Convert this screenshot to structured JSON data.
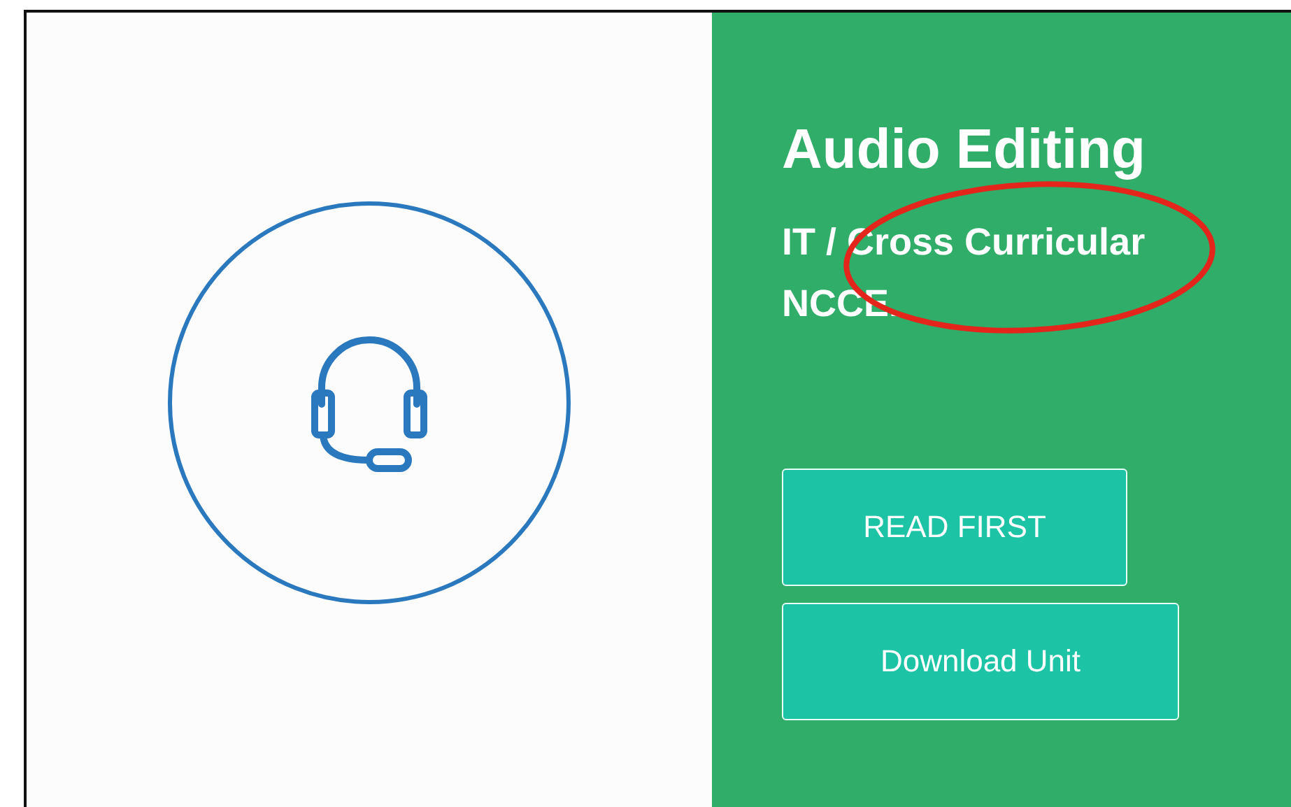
{
  "title": "Audio Editing",
  "subtitle_lines": [
    "IT / Cross Curricular",
    "NCCE."
  ],
  "buttons": [
    "READ FIRST",
    "Download Unit"
  ],
  "annotation": {
    "kind": "ellipse"
  }
}
